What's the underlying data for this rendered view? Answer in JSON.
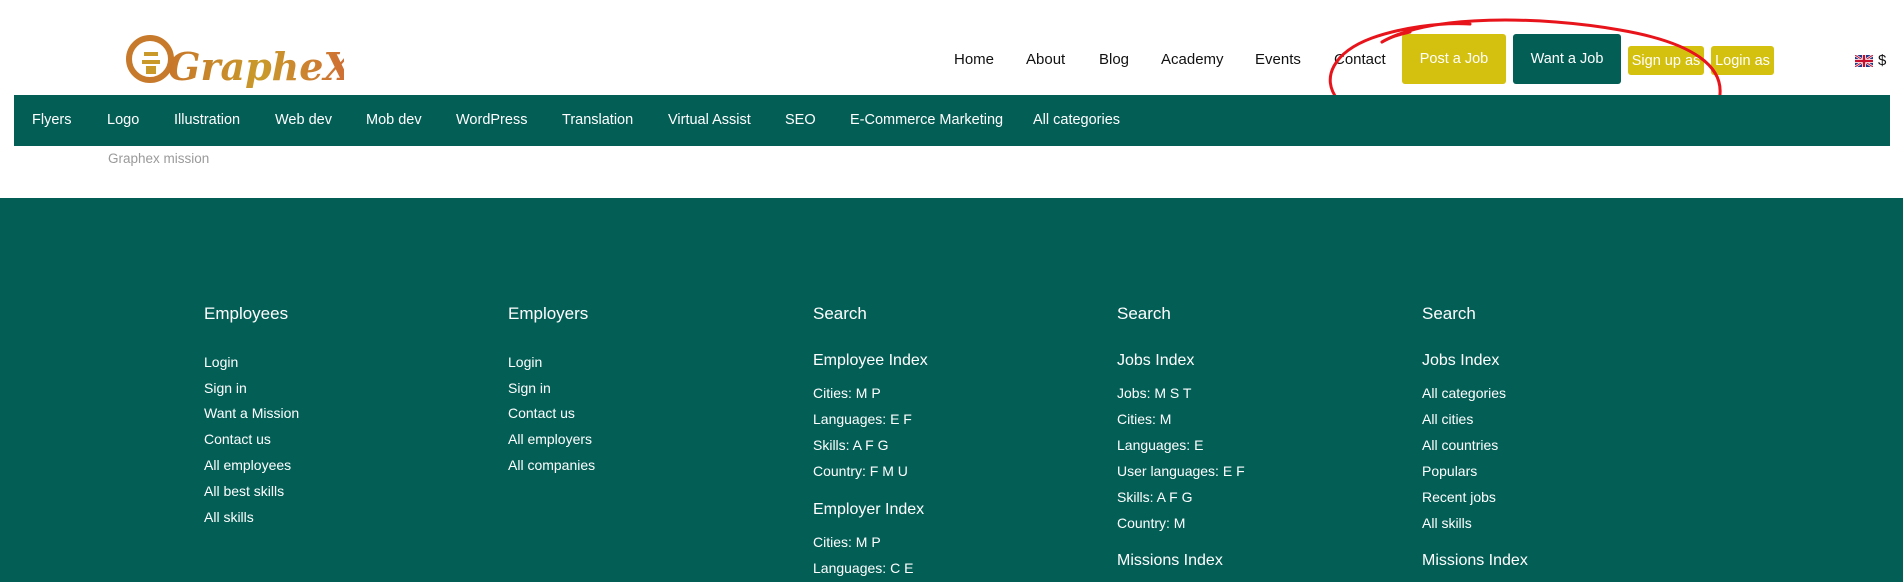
{
  "logo": {
    "text": "GrapheX"
  },
  "nav": {
    "home": "Home",
    "about": "About",
    "blog": "Blog",
    "academy": "Academy",
    "events": "Events",
    "contact": "Contact"
  },
  "buttons": {
    "post_job": "Post a Job",
    "want_job": "Want a Job",
    "sign_up": "Sign up as",
    "login": "Login as"
  },
  "currency": "$",
  "colors": {
    "brand_green": "#035e56",
    "brand_yellow": "#d4c00f",
    "annotation_red": "#e8141b"
  },
  "categories": [
    "Flyers",
    "Logo",
    "Illustration",
    "Web dev",
    "Mob dev",
    "WordPress",
    "Translation",
    "Virtual Assist",
    "SEO",
    "E-Commerce Marketing",
    "All categories"
  ],
  "breadcrumb": "Graphex mission",
  "footer": {
    "employees": {
      "title": "Employees",
      "links": [
        "Login",
        "Sign in",
        "Want a Mission",
        "Contact us",
        "All employees",
        "All best skills",
        "All skills"
      ]
    },
    "employers": {
      "title": "Employers",
      "links": [
        "Login",
        "Sign in",
        "Contact us",
        "All employers",
        "All companies"
      ]
    },
    "search1": {
      "title": "Search",
      "sub1": "Employee Index",
      "links1": [
        "Cities: M P",
        "Languages: E F",
        "Skills: A F G",
        "Country: F M U"
      ],
      "sub2": "Employer Index",
      "links2": [
        "Cities: M P",
        "Languages: C E"
      ]
    },
    "search2": {
      "title": "Search",
      "sub1": "Jobs Index",
      "links1": [
        "Jobs: M S T",
        "Cities: M",
        "Languages: E",
        "User languages: E F",
        "Skills: A F G",
        "Country: M"
      ],
      "sub2": "Missions Index"
    },
    "search3": {
      "title": "Search",
      "sub1": "Jobs Index",
      "links1": [
        "All categories",
        "All cities",
        "All countries",
        "Populars",
        "Recent jobs",
        "All skills"
      ],
      "sub2": "Missions Index"
    }
  }
}
